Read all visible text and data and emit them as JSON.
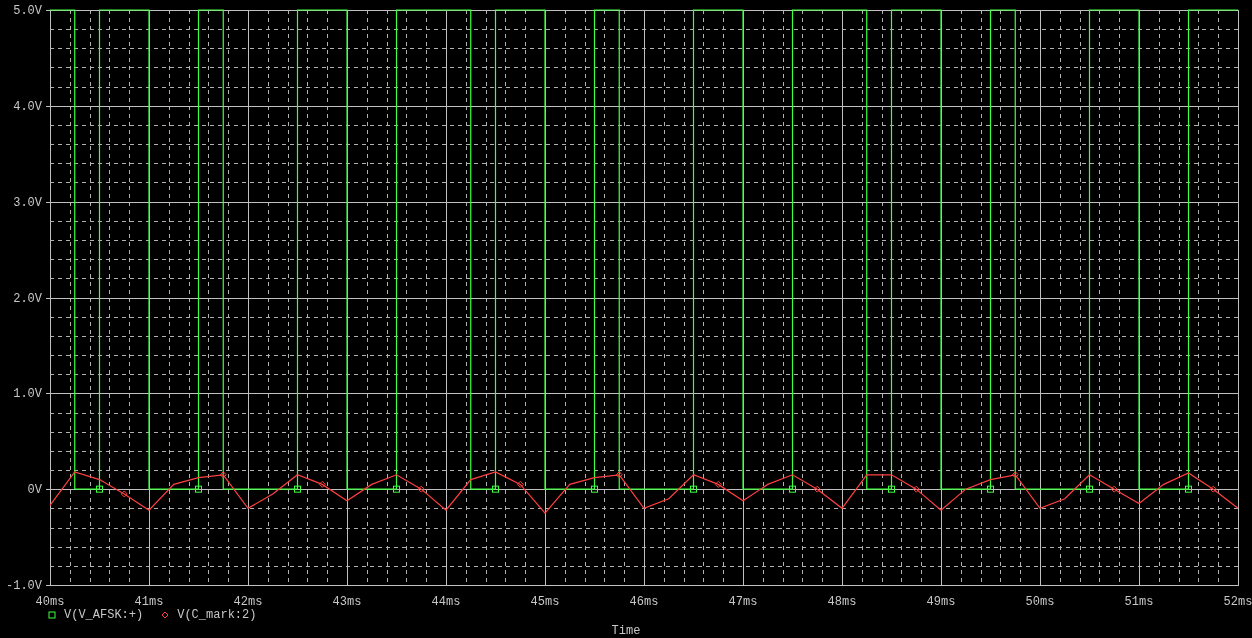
{
  "plot": {
    "legend_symbols": [
      {
        "kind": "square"
      },
      {
        "kind": "diamond"
      }
    ],
    "chart_data": {
      "type": "line",
      "xlabel": "Time",
      "grid": true,
      "xlim": [
        40,
        52
      ],
      "ylim": [
        -1,
        5
      ],
      "xticks": [
        {
          "value": 40,
          "label": "40ms"
        },
        {
          "value": 41,
          "label": "41ms"
        },
        {
          "value": 42,
          "label": "42ms"
        },
        {
          "value": 43,
          "label": "43ms"
        },
        {
          "value": 44,
          "label": "44ms"
        },
        {
          "value": 45,
          "label": "45ms"
        },
        {
          "value": 46,
          "label": "46ms"
        },
        {
          "value": 47,
          "label": "47ms"
        },
        {
          "value": 48,
          "label": "48ms"
        },
        {
          "value": 49,
          "label": "49ms"
        },
        {
          "value": 50,
          "label": "50ms"
        },
        {
          "value": 51,
          "label": "51ms"
        },
        {
          "value": 52,
          "label": "52ms"
        }
      ],
      "yticks": [
        {
          "value": 5,
          "label": "5.0V"
        },
        {
          "value": 4,
          "label": "4.0V"
        },
        {
          "value": 3,
          "label": "3.0V"
        },
        {
          "value": 2,
          "label": "2.0V"
        },
        {
          "value": 1,
          "label": "1.0V"
        },
        {
          "value": 0,
          "label": "0V"
        },
        {
          "value": -1,
          "label": "-1.0V"
        }
      ],
      "x": [
        40,
        40.25,
        40.25,
        40.5,
        40.5,
        40.75,
        41,
        41,
        41.25,
        41.5,
        41.5,
        41.75,
        41.75,
        42,
        42.25,
        42.5,
        42.5,
        42.75,
        43,
        43,
        43.25,
        43.5,
        43.5,
        43.75,
        44,
        44.25,
        44.25,
        44.5,
        44.5,
        44.75,
        45,
        45,
        45.25,
        45.5,
        45.5,
        45.75,
        45.75,
        46,
        46.25,
        46.5,
        46.5,
        46.75,
        47,
        47,
        47.25,
        47.5,
        47.5,
        47.75,
        48,
        48.25,
        48.25,
        48.5,
        48.5,
        48.75,
        49,
        49,
        49.25,
        49.5,
        49.5,
        49.75,
        49.75,
        50,
        50.25,
        50.5,
        50.5,
        50.75,
        51,
        51,
        51.25,
        51.5,
        51.5,
        51.75,
        52
      ],
      "series": [
        {
          "name": "V(V_AFSK:+)",
          "color": "#40ff40",
          "values": [
            5,
            5,
            0,
            0,
            5,
            5,
            5,
            0,
            0,
            0,
            5,
            5,
            0,
            0,
            0,
            0,
            5,
            5,
            5,
            0,
            0,
            0,
            5,
            5,
            5,
            5,
            0,
            0,
            5,
            5,
            5,
            0,
            0,
            0,
            5,
            5,
            0,
            0,
            0,
            0,
            5,
            5,
            5,
            0,
            0,
            0,
            5,
            5,
            5,
            5,
            0,
            0,
            5,
            5,
            5,
            0,
            0,
            0,
            5,
            5,
            0,
            0,
            0,
            0,
            5,
            5,
            5,
            0,
            0,
            0,
            5,
            5,
            5
          ]
        },
        {
          "name": "V(C_mark:2)",
          "color": "#ff4040",
          "values": [
            -0.17,
            0.18,
            0.18,
            0.1,
            0.1,
            -0.05,
            -0.22,
            -0.22,
            0.05,
            0.12,
            0.12,
            0.15,
            0.15,
            -0.2,
            -0.05,
            0.15,
            0.15,
            0.05,
            -0.12,
            -0.12,
            0.05,
            0.15,
            0.15,
            0,
            -0.22,
            0.1,
            0.1,
            0.18,
            0.18,
            0.05,
            -0.25,
            -0.25,
            0.05,
            0.12,
            0.12,
            0.15,
            0.15,
            -0.2,
            -0.1,
            0.15,
            0.15,
            0.05,
            -0.12,
            -0.12,
            0.05,
            0.15,
            0.15,
            0,
            -0.2,
            0.15,
            0.15,
            0.15,
            0.15,
            0,
            -0.22,
            -0.22,
            0,
            0.1,
            0.1,
            0.15,
            0.15,
            -0.2,
            -0.1,
            0.15,
            0.15,
            0,
            -0.15,
            -0.15,
            0.05,
            0.17,
            0.17,
            0,
            -0.2
          ]
        }
      ]
    }
  }
}
